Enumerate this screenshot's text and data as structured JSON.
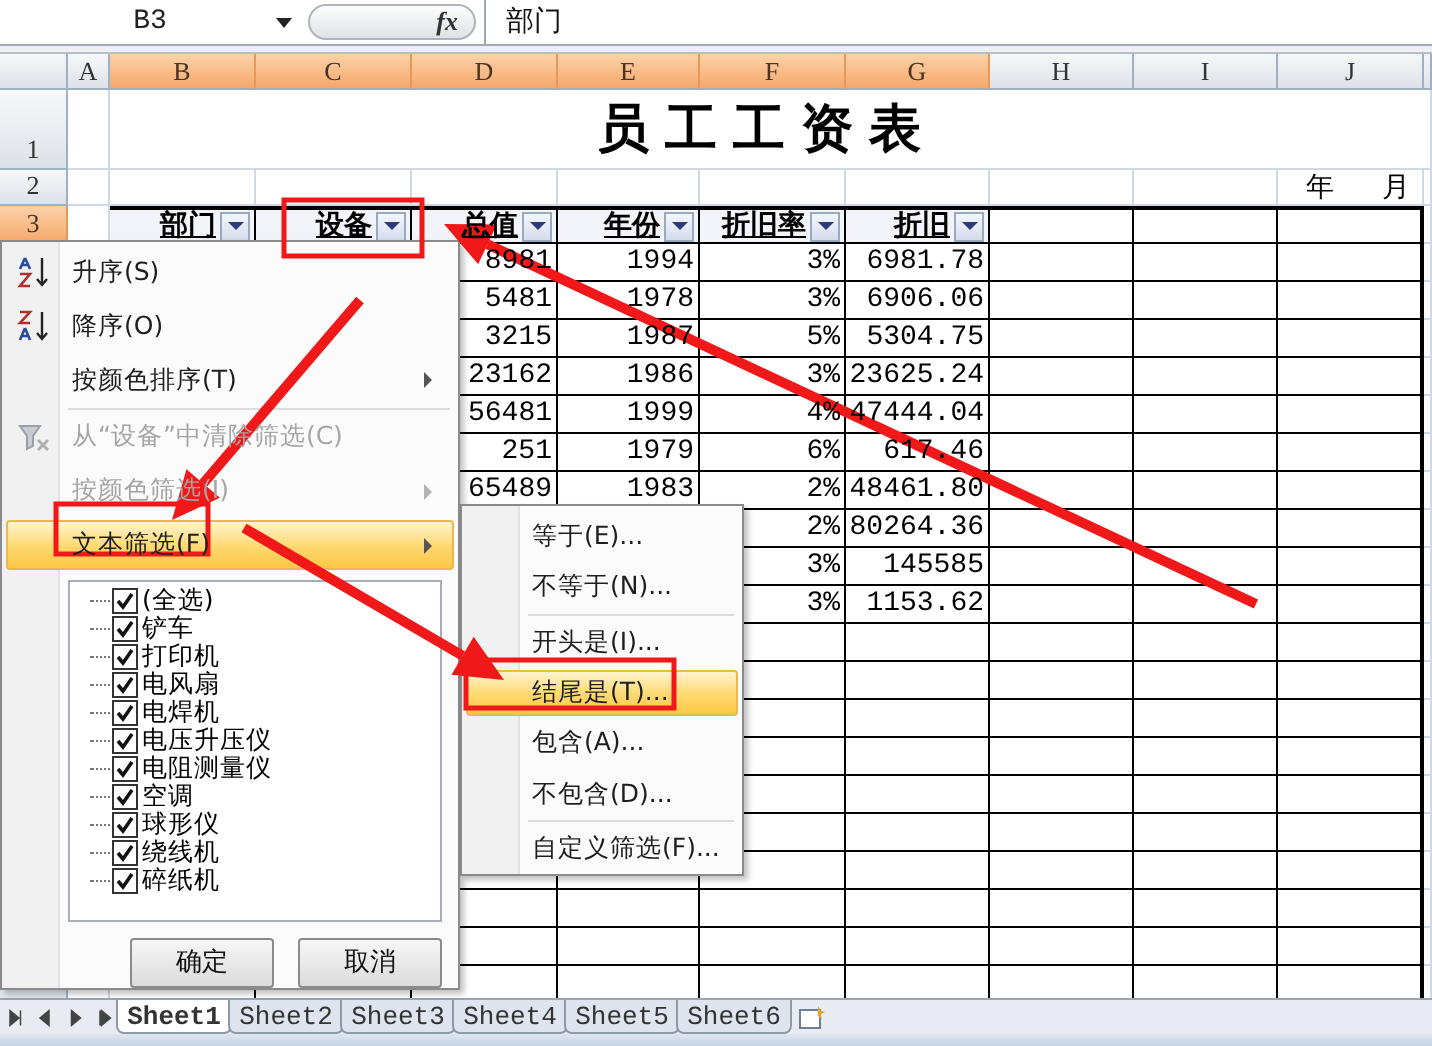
{
  "formula_bar": {
    "cell_ref": "B3",
    "fx_label": "fx",
    "value": "部门"
  },
  "columns": [
    {
      "label": "A",
      "selected": false
    },
    {
      "label": "B",
      "selected": true
    },
    {
      "label": "C",
      "selected": true
    },
    {
      "label": "D",
      "selected": true
    },
    {
      "label": "E",
      "selected": true
    },
    {
      "label": "F",
      "selected": true
    },
    {
      "label": "G",
      "selected": true
    },
    {
      "label": "H",
      "selected": false
    },
    {
      "label": "I",
      "selected": false
    },
    {
      "label": "J",
      "selected": false
    }
  ],
  "rows": [
    {
      "label": "1",
      "selected": false
    },
    {
      "label": "2",
      "selected": false
    },
    {
      "label": "3",
      "selected": true
    }
  ],
  "title": "员工工资表",
  "date_labels": [
    "年",
    "月"
  ],
  "header_cells": [
    "部门",
    "设备",
    "总值",
    "年份",
    "折旧率",
    "折旧"
  ],
  "data_rows": [
    {
      "total": "8981",
      "year": "1994",
      "rate": "3%",
      "depreciation": "6981.78"
    },
    {
      "total": "5481",
      "year": "1978",
      "rate": "3%",
      "depreciation": "6906.06"
    },
    {
      "total": "3215",
      "year": "1987",
      "rate": "5%",
      "depreciation": "5304.75"
    },
    {
      "total": "23162",
      "year": "1986",
      "rate": "3%",
      "depreciation": "23625.24"
    },
    {
      "total": "56481",
      "year": "1999",
      "rate": "4%",
      "depreciation": "47444.04"
    },
    {
      "total": "251",
      "year": "1979",
      "rate": "6%",
      "depreciation": "617.46"
    },
    {
      "total": "65489",
      "year": "1983",
      "rate": "2%",
      "depreciation": "48461.80"
    },
    {
      "rate": "2%",
      "depreciation": "80264.36"
    },
    {
      "rate": "3%",
      "depreciation": "145585"
    },
    {
      "rate": "3%",
      "depreciation": "1153.62"
    }
  ],
  "filter_menu": {
    "items": [
      {
        "kind": "sort_asc",
        "label": "升序(S)",
        "disabled": false,
        "selected": false,
        "submenu": false
      },
      {
        "kind": "sort_desc",
        "label": "降序(O)",
        "disabled": false,
        "selected": false,
        "submenu": false
      },
      {
        "kind": "item",
        "label": "按颜色排序(T)",
        "disabled": false,
        "selected": false,
        "submenu": true
      },
      {
        "kind": "separator"
      },
      {
        "kind": "clear_filter",
        "label": "从“设备”中清除筛选(C)",
        "disabled": true,
        "selected": false,
        "submenu": false
      },
      {
        "kind": "item",
        "label": "按颜色筛选(I)",
        "disabled": true,
        "selected": false,
        "submenu": true
      },
      {
        "kind": "item",
        "label": "文本筛选(F)",
        "disabled": false,
        "selected": true,
        "submenu": true
      }
    ],
    "values": [
      {
        "label": "(全选)",
        "checked": true
      },
      {
        "label": "铲车",
        "checked": true
      },
      {
        "label": "打印机",
        "checked": true
      },
      {
        "label": "电风扇",
        "checked": true
      },
      {
        "label": "电焊机",
        "checked": true
      },
      {
        "label": "电压升压仪",
        "checked": true
      },
      {
        "label": "电阻测量仪",
        "checked": true
      },
      {
        "label": "空调",
        "checked": true
      },
      {
        "label": "球形仪",
        "checked": true
      },
      {
        "label": "绕线机",
        "checked": true
      },
      {
        "label": "碎纸机",
        "checked": true
      }
    ],
    "buttons": [
      "确定",
      "取消"
    ]
  },
  "text_filter_menu": {
    "items": [
      {
        "kind": "item",
        "label": "等于(E)...",
        "selected": false
      },
      {
        "kind": "item",
        "label": "不等于(N)...",
        "selected": false
      },
      {
        "kind": "separator"
      },
      {
        "kind": "item",
        "label": "开头是(I)...",
        "selected": false
      },
      {
        "kind": "item",
        "label": "结尾是(T)...",
        "selected": true
      },
      {
        "kind": "item",
        "label": "包含(A)...",
        "selected": false
      },
      {
        "kind": "item",
        "label": "不包含(D)...",
        "selected": false
      },
      {
        "kind": "separator"
      },
      {
        "kind": "item",
        "label": "自定义筛选(F)...",
        "selected": false
      }
    ]
  },
  "sheet_tabs": [
    {
      "label": "Sheet1",
      "selected": true
    },
    {
      "label": "Sheet2",
      "selected": false
    },
    {
      "label": "Sheet3",
      "selected": false
    },
    {
      "label": "Sheet4",
      "selected": false
    },
    {
      "label": "Sheet5",
      "selected": false
    },
    {
      "label": "Sheet6",
      "selected": false
    }
  ]
}
